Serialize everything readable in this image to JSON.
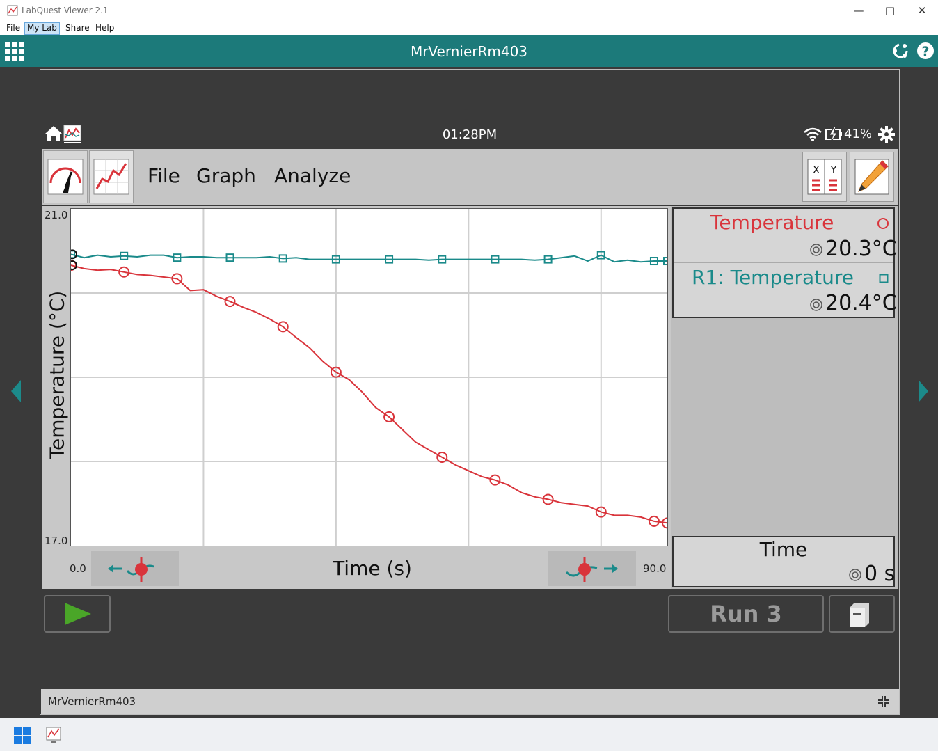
{
  "window": {
    "title": "LabQuest Viewer 2.1",
    "menus": [
      "File",
      "My Lab",
      "Share",
      "Help"
    ],
    "selected_menu": "My Lab"
  },
  "header": {
    "title": "MrVernierRm403"
  },
  "device": {
    "time": "01:28PM",
    "battery": "41%",
    "menus": [
      "File",
      "Graph",
      "Analyze"
    ]
  },
  "chart_data": {
    "type": "line",
    "xlabel": "Time (s)",
    "ylabel": "Temperature (°C)",
    "xlim": [
      0.0,
      90.0
    ],
    "ylim": [
      17.0,
      21.0
    ],
    "x_min_label": "0.0",
    "x_max_label": "90.0",
    "y_min_label": "17.0",
    "y_max_label": "21.0",
    "grid": true,
    "series": [
      {
        "name": "Temperature",
        "color": "#d9343b",
        "marker": "circle",
        "x": [
          0,
          2,
          4,
          6,
          8,
          10,
          12,
          14,
          16,
          18,
          20,
          22,
          24,
          26,
          28,
          30,
          32,
          34,
          36,
          38,
          40,
          42,
          44,
          46,
          48,
          50,
          52,
          54,
          56,
          58,
          60,
          62,
          64,
          66,
          68,
          70,
          72,
          74,
          76,
          78,
          80,
          82,
          84,
          86,
          88,
          90
        ],
        "y": [
          20.33,
          20.29,
          20.27,
          20.28,
          20.25,
          20.22,
          20.21,
          20.19,
          20.17,
          20.03,
          20.04,
          19.96,
          19.9,
          19.83,
          19.77,
          19.69,
          19.6,
          19.47,
          19.35,
          19.19,
          19.06,
          18.97,
          18.82,
          18.64,
          18.53,
          18.38,
          18.23,
          18.14,
          18.05,
          17.96,
          17.89,
          17.82,
          17.78,
          17.72,
          17.63,
          17.58,
          17.55,
          17.51,
          17.49,
          17.47,
          17.4,
          17.36,
          17.36,
          17.34,
          17.29,
          17.27
        ],
        "marker_x": [
          0,
          8,
          16,
          24,
          32,
          40,
          48,
          56,
          64,
          72,
          80,
          88,
          90
        ]
      },
      {
        "name": "R1: Temperature",
        "color": "#1a8a8a",
        "marker": "square",
        "x": [
          0,
          2,
          4,
          6,
          8,
          10,
          12,
          14,
          16,
          18,
          20,
          22,
          24,
          26,
          28,
          30,
          32,
          34,
          36,
          38,
          40,
          42,
          44,
          46,
          48,
          50,
          52,
          54,
          56,
          58,
          60,
          62,
          64,
          66,
          68,
          70,
          72,
          74,
          76,
          78,
          80,
          82,
          84,
          86,
          88,
          90
        ],
        "y": [
          20.46,
          20.42,
          20.45,
          20.43,
          20.44,
          20.43,
          20.45,
          20.45,
          20.42,
          20.43,
          20.43,
          20.42,
          20.42,
          20.42,
          20.42,
          20.43,
          20.41,
          20.42,
          20.4,
          20.4,
          20.4,
          20.4,
          20.4,
          20.4,
          20.4,
          20.4,
          20.4,
          20.39,
          20.4,
          20.4,
          20.4,
          20.4,
          20.4,
          20.4,
          20.4,
          20.39,
          20.4,
          20.42,
          20.44,
          20.38,
          20.45,
          20.37,
          20.39,
          20.37,
          20.38,
          20.38
        ],
        "marker_x": [
          0,
          8,
          16,
          24,
          32,
          40,
          48,
          56,
          64,
          72,
          80,
          88,
          90
        ]
      }
    ]
  },
  "meters": [
    {
      "label": "Temperature",
      "value": "20.3°C",
      "color": "#d9343b"
    },
    {
      "label": "R1: Temperature",
      "value": "20.4°C",
      "color": "#1a8a8a"
    }
  ],
  "time_meter": {
    "label": "Time",
    "value": "0 s"
  },
  "run": {
    "label": "Run 3"
  },
  "footer": {
    "name": "MrVernierRm403"
  }
}
